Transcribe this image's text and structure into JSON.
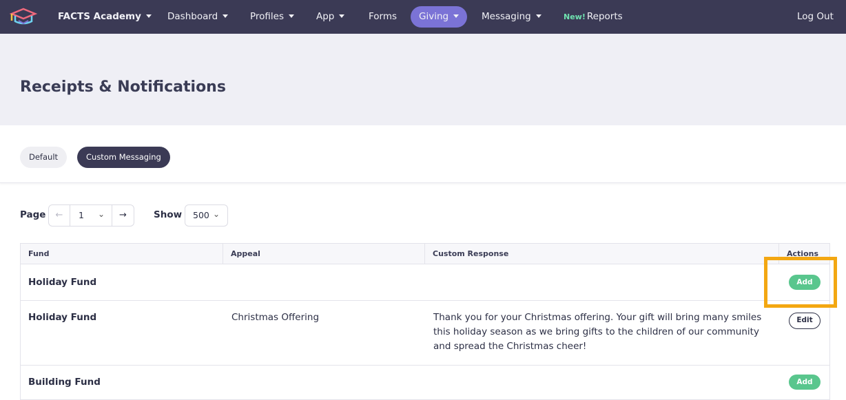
{
  "nav": {
    "brand": "FACTS Academy",
    "items": [
      {
        "label": "Dashboard",
        "caret": true
      },
      {
        "label": "Profiles",
        "caret": true
      },
      {
        "label": "App",
        "caret": true
      },
      {
        "label": "Forms",
        "caret": false
      },
      {
        "label": "Giving",
        "caret": true,
        "active": true
      },
      {
        "label": "Messaging",
        "caret": true
      }
    ],
    "reports_badge": "New!",
    "reports_label": "Reports",
    "logout": "Log Out"
  },
  "page": {
    "title": "Receipts & Notifications"
  },
  "toggle": {
    "default_label": "Default",
    "custom_label": "Custom Messaging",
    "active": "custom"
  },
  "pager": {
    "page_label": "Page",
    "prev_arrow": "←",
    "page_value": "1",
    "next_arrow": "→",
    "show_label": "Show",
    "show_value": "500"
  },
  "table": {
    "headers": [
      "Fund",
      "Appeal",
      "Custom Response",
      "Actions"
    ],
    "rows": [
      {
        "fund": "Holiday Fund",
        "appeal": "",
        "response": "",
        "action": "Add"
      },
      {
        "fund": "Holiday Fund",
        "appeal": "Christmas Offering",
        "response": "Thank you for your Christmas offering. Your gift will bring many smiles this holiday season as we bring gifts to the children of our community and spread the Christmas cheer!",
        "action": "Edit"
      },
      {
        "fund": "Building Fund",
        "appeal": "",
        "response": "",
        "action": "Add"
      }
    ]
  },
  "colors": {
    "nav_bg": "#3b3a55",
    "active_pill": "#7b73d6",
    "add_button": "#59c68d",
    "highlight": "#f3a712"
  }
}
